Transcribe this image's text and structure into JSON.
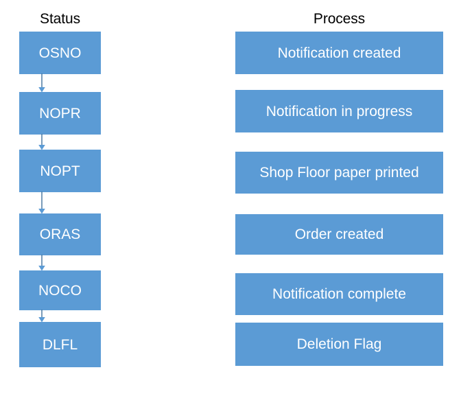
{
  "diagram": {
    "columns": [
      {
        "title": "Status",
        "nodes": [
          {
            "label": "OSNO"
          },
          {
            "label": "NOPR"
          },
          {
            "label": "NOPT"
          },
          {
            "label": "ORAS"
          },
          {
            "label": "NOCO"
          },
          {
            "label": "DLFL"
          }
        ]
      },
      {
        "title": "Process",
        "nodes": [
          {
            "label": "Notification created"
          },
          {
            "label": "Notification in progress"
          },
          {
            "label": "Shop Floor paper printed"
          },
          {
            "label": "Order created"
          },
          {
            "label": "Notification complete"
          },
          {
            "label": "Deletion Flag"
          }
        ]
      }
    ],
    "flow": [
      {
        "from": "OSNO",
        "to": "NOPR"
      },
      {
        "from": "NOPR",
        "to": "NOPT"
      },
      {
        "from": "NOPT",
        "to": "ORAS"
      },
      {
        "from": "ORAS",
        "to": "NOCO"
      },
      {
        "from": "NOCO",
        "to": "DLFL"
      }
    ],
    "colors": {
      "node_fill": "#5B9BD5",
      "node_text": "#FFFFFF",
      "connector": "#41719C",
      "title_text": "#000000",
      "background": "#FFFFFF"
    }
  }
}
